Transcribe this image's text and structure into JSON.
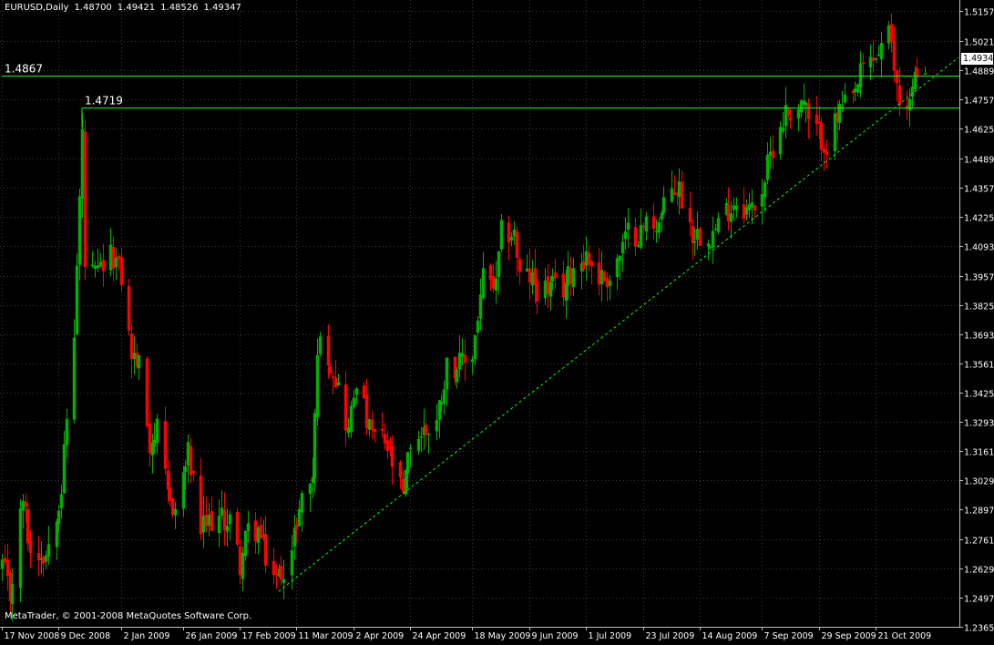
{
  "header": {
    "symbol": "EURUSD,Daily",
    "open": "1.48700",
    "high": "1.49421",
    "low": "1.48526",
    "close": "1.49347"
  },
  "copyright": "MetaTrader, © 2001-2008 MetaQuotes Software Corp.",
  "current_price_label": "1.49347",
  "colors": {
    "background": "#000000",
    "up_candle": "#00b000",
    "down_candle": "#ff0000",
    "grid": "#3a3a3a",
    "horizontal_lines": "#00ff00",
    "trendline": "#00ff00",
    "text": "#ffffff"
  },
  "chart_data": {
    "type": "candlestick",
    "y_ticks": [
      "1.51570",
      "1.50210",
      "1.48890",
      "1.47570",
      "1.46250",
      "1.44890",
      "1.43570",
      "1.42250",
      "1.40930",
      "1.39570",
      "1.38250",
      "1.36930",
      "1.35610",
      "1.34250",
      "1.32930",
      "1.31610",
      "1.30290",
      "1.28970",
      "1.27610",
      "1.26290",
      "1.24970",
      "1.23650"
    ],
    "ylim": [
      1.2365,
      1.5208
    ],
    "x_ticks": [
      "17 Nov 2008",
      "9 Dec 2008",
      "2 Jan 2009",
      "26 Jan 2009",
      "17 Feb 2009",
      "11 Mar 2009",
      "2 Apr 2009",
      "24 Apr 2009",
      "18 May 2009",
      "9 Jun 2009",
      "1 Jul 2009",
      "23 Jul 2009",
      "14 Aug 2009",
      "7 Sep 2009",
      "29 Sep 2009",
      "21 Oct 2009"
    ],
    "grid": true,
    "horizontal_lines": [
      {
        "label": "1.4867",
        "value": 1.4867,
        "start_date": "17 Nov 2008"
      },
      {
        "label": "1.4719",
        "value": 1.4719,
        "start_date": "18 Dec 2008"
      }
    ],
    "trendline": {
      "style": "dashed",
      "from": {
        "date": "4 Mar 2009",
        "value": 1.2525
      },
      "to": {
        "date": "5 Nov 2009",
        "value": 1.479
      }
    },
    "anchors": [
      {
        "date": "17 Nov 2008",
        "value": 1.265
      },
      {
        "date": "20 Nov 2008",
        "value": 1.25
      },
      {
        "date": "25 Nov 2008",
        "value": 1.295
      },
      {
        "date": "28 Nov 2008",
        "value": 1.27
      },
      {
        "date": "4 Dec 2008",
        "value": 1.27
      },
      {
        "date": "10 Dec 2008",
        "value": 1.3
      },
      {
        "date": "12 Dec 2008",
        "value": 1.33
      },
      {
        "date": "15 Dec 2008",
        "value": 1.37
      },
      {
        "date": "17 Dec 2008",
        "value": 1.43
      },
      {
        "date": "18 Dec 2008",
        "value": 1.46
      },
      {
        "date": "19 Dec 2008",
        "value": 1.4
      },
      {
        "date": "23 Dec 2008",
        "value": 1.395
      },
      {
        "date": "26 Dec 2008",
        "value": 1.4
      },
      {
        "date": "30 Dec 2008",
        "value": 1.405
      },
      {
        "date": "2 Jan 2009",
        "value": 1.395
      },
      {
        "date": "6 Jan 2009",
        "value": 1.36
      },
      {
        "date": "9 Jan 2009",
        "value": 1.355
      },
      {
        "date": "13 Jan 2009",
        "value": 1.32
      },
      {
        "date": "16 Jan 2009",
        "value": 1.325
      },
      {
        "date": "20 Jan 2009",
        "value": 1.295
      },
      {
        "date": "23 Jan 2009",
        "value": 1.29
      },
      {
        "date": "28 Jan 2009",
        "value": 1.315
      },
      {
        "date": "2 Feb 2009",
        "value": 1.28
      },
      {
        "date": "6 Feb 2009",
        "value": 1.285
      },
      {
        "date": "11 Feb 2009",
        "value": 1.285
      },
      {
        "date": "13 Feb 2009",
        "value": 1.285
      },
      {
        "date": "17 Feb 2009",
        "value": 1.265
      },
      {
        "date": "20 Feb 2009",
        "value": 1.28
      },
      {
        "date": "24 Feb 2009",
        "value": 1.28
      },
      {
        "date": "27 Feb 2009",
        "value": 1.268
      },
      {
        "date": "3 Mar 2009",
        "value": 1.258
      },
      {
        "date": "5 Mar 2009",
        "value": 1.262
      },
      {
        "date": "9 Mar 2009",
        "value": 1.27
      },
      {
        "date": "11 Mar 2009",
        "value": 1.285
      },
      {
        "date": "13 Mar 2009",
        "value": 1.295
      },
      {
        "date": "17 Mar 2009",
        "value": 1.305
      },
      {
        "date": "18 Mar 2009",
        "value": 1.33
      },
      {
        "date": "19 Mar 2009",
        "value": 1.365
      },
      {
        "date": "23 Mar 2009",
        "value": 1.36
      },
      {
        "date": "26 Mar 2009",
        "value": 1.35
      },
      {
        "date": "31 Mar 2009",
        "value": 1.325
      },
      {
        "date": "3 Apr 2009",
        "value": 1.35
      },
      {
        "date": "8 Apr 2009",
        "value": 1.325
      },
      {
        "date": "14 Apr 2009",
        "value": 1.32
      },
      {
        "date": "17 Apr 2009",
        "value": 1.31
      },
      {
        "date": "21 Apr 2009",
        "value": 1.295
      },
      {
        "date": "24 Apr 2009",
        "value": 1.32
      },
      {
        "date": "29 Apr 2009",
        "value": 1.325
      },
      {
        "date": "4 May 2009",
        "value": 1.33
      },
      {
        "date": "8 May 2009",
        "value": 1.355
      },
      {
        "date": "13 May 2009",
        "value": 1.355
      },
      {
        "date": "18 May 2009",
        "value": 1.36
      },
      {
        "date": "22 May 2009",
        "value": 1.395
      },
      {
        "date": "27 May 2009",
        "value": 1.39
      },
      {
        "date": "29 May 2009",
        "value": 1.415
      },
      {
        "date": "3 Jun 2009",
        "value": 1.415
      },
      {
        "date": "5 Jun 2009",
        "value": 1.395
      },
      {
        "date": "9 Jun 2009",
        "value": 1.395
      },
      {
        "date": "12 Jun 2009",
        "value": 1.39
      },
      {
        "date": "17 Jun 2009",
        "value": 1.39
      },
      {
        "date": "22 Jun 2009",
        "value": 1.39
      },
      {
        "date": "26 Jun 2009",
        "value": 1.4
      },
      {
        "date": "1 Jul 2009",
        "value": 1.405
      },
      {
        "date": "6 Jul 2009",
        "value": 1.395
      },
      {
        "date": "10 Jul 2009",
        "value": 1.395
      },
      {
        "date": "14 Jul 2009",
        "value": 1.405
      },
      {
        "date": "17 Jul 2009",
        "value": 1.415
      },
      {
        "date": "22 Jul 2009",
        "value": 1.415
      },
      {
        "date": "24 Jul 2009",
        "value": 1.42
      },
      {
        "date": "29 Jul 2009",
        "value": 1.42
      },
      {
        "date": "3 Aug 2009",
        "value": 1.435
      },
      {
        "date": "6 Aug 2009",
        "value": 1.435
      },
      {
        "date": "11 Aug 2009",
        "value": 1.415
      },
      {
        "date": "14 Aug 2009",
        "value": 1.415
      },
      {
        "date": "19 Aug 2009",
        "value": 1.415
      },
      {
        "date": "24 Aug 2009",
        "value": 1.425
      },
      {
        "date": "28 Aug 2009",
        "value": 1.43
      },
      {
        "date": "2 Sep 2009",
        "value": 1.425
      },
      {
        "date": "7 Sep 2009",
        "value": 1.435
      },
      {
        "date": "11 Sep 2009",
        "value": 1.455
      },
      {
        "date": "16 Sep 2009",
        "value": 1.47
      },
      {
        "date": "18 Sep 2009",
        "value": 1.47
      },
      {
        "date": "23 Sep 2009",
        "value": 1.475
      },
      {
        "date": "25 Sep 2009",
        "value": 1.465
      },
      {
        "date": "29 Sep 2009",
        "value": 1.46
      },
      {
        "date": "2 Oct 2009",
        "value": 1.455
      },
      {
        "date": "7 Oct 2009",
        "value": 1.47
      },
      {
        "date": "12 Oct 2009",
        "value": 1.475
      },
      {
        "date": "16 Oct 2009",
        "value": 1.49
      },
      {
        "date": "21 Oct 2009",
        "value": 1.495
      },
      {
        "date": "23 Oct 2009",
        "value": 1.5
      },
      {
        "date": "26 Oct 2009",
        "value": 1.505
      },
      {
        "date": "28 Oct 2009",
        "value": 1.49
      },
      {
        "date": "30 Oct 2009",
        "value": 1.475
      },
      {
        "date": "3 Nov 2009",
        "value": 1.475
      },
      {
        "date": "5 Nov 2009",
        "value": 1.485
      },
      {
        "date": "9 Nov 2009",
        "value": 1.4935
      }
    ]
  }
}
